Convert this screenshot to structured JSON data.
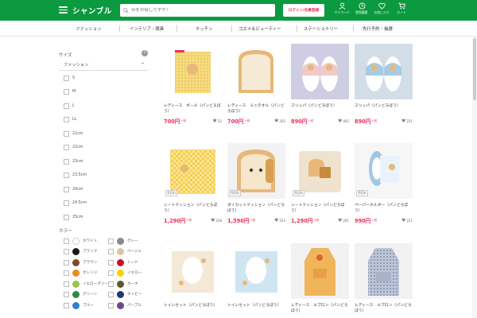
{
  "header": {
    "logo": "シャンブル",
    "search_placeholder": "何をお探しですか？",
    "login_label": "ログイン/会員登録",
    "icons": [
      {
        "name": "mypage-icon",
        "label": "マイページ"
      },
      {
        "name": "history-icon",
        "label": "閲覧履歴"
      },
      {
        "name": "favorite-icon",
        "label": "お気に入り"
      },
      {
        "name": "cart-icon",
        "label": "カート"
      }
    ]
  },
  "categories": [
    "ファッション",
    "インテリア・寝具",
    "キッチン",
    "コスメ＆ビューティー",
    "ステーショナリー",
    "先行予約・抽選"
  ],
  "sidebar": {
    "size_heading": "サイズ",
    "fashion_label": "ファッション",
    "sizes": [
      "S",
      "M",
      "L",
      "LL",
      "21cm",
      "22cm",
      "23cm",
      "23.5cm",
      "24cm",
      "24.5cm",
      "25cm"
    ],
    "color_heading": "カラー",
    "colors": [
      {
        "name": "ホワイト",
        "hex": "#ffffff"
      },
      {
        "name": "グレー",
        "hex": "#8a8a8a"
      },
      {
        "name": "ブラック",
        "hex": "#1a1a1a"
      },
      {
        "name": "ベージュ",
        "hex": "#d8c6a4"
      },
      {
        "name": "ブラウン",
        "hex": "#7a4b27"
      },
      {
        "name": "レッド",
        "hex": "#c8102e"
      },
      {
        "name": "オレンジ",
        "hex": "#f08a24"
      },
      {
        "name": "イエロー",
        "hex": "#f5d400"
      },
      {
        "name": "イエローグリーン",
        "hex": "#9bc34a"
      },
      {
        "name": "カーキ",
        "hex": "#5c5a2e"
      },
      {
        "name": "グリーン",
        "hex": "#2f8a3e"
      },
      {
        "name": "ネイビー",
        "hex": "#1f3a6b"
      },
      {
        "name": "ブルー",
        "hex": "#2f7fd1"
      },
      {
        "name": "パープル",
        "hex": "#6a4a8f"
      }
    ]
  },
  "products": [
    {
      "title": "レディース　ボール（パンどろぼう）",
      "price": "700円",
      "tax": "+税",
      "likes": "22",
      "badge": "",
      "type": "towel"
    },
    {
      "title": "レディース　ミニタオル（パンどろぼう）",
      "price": "700円",
      "tax": "+税",
      "likes": "202",
      "badge": "",
      "type": "bread"
    },
    {
      "title": "スリッパ（パンどろぼう）",
      "price": "890円",
      "tax": "+税",
      "likes": "492",
      "badge": "",
      "type": "slipper"
    },
    {
      "title": "スリッパ（パンどろぼう）",
      "price": "890円",
      "tax": "+税",
      "likes": "231",
      "badge": "",
      "type": "slipper2"
    },
    {
      "title": "シートクッション（パンどろぼう）",
      "price": "1,290円",
      "tax": "+税",
      "likes": "228",
      "badge": "売切れ",
      "type": "check"
    },
    {
      "title": "ダイカットクッション（パンどろぼう）",
      "price": "1,590円",
      "tax": "+税",
      "likes": "224",
      "badge": "売切れ",
      "type": "diecut"
    },
    {
      "title": "シートクッション（パンどろぼう）",
      "price": "1,290円",
      "tax": "+税",
      "likes": "261",
      "badge": "売切れ",
      "type": "square"
    },
    {
      "title": "ペーパーホルダー（パンどろぼう）",
      "price": "990円",
      "tax": "+税",
      "likes": "221",
      "badge": "売切れ",
      "type": "holder"
    },
    {
      "title": "トイレセット（パンどろぼう）",
      "price": "",
      "tax": "",
      "likes": "",
      "badge": "",
      "type": "toilet1"
    },
    {
      "title": "トイレセット（パンどろぼう）",
      "price": "",
      "tax": "",
      "likes": "",
      "badge": "",
      "type": "toilet2"
    },
    {
      "title": "レディース　エプロン（パンどろぼう）",
      "price": "",
      "tax": "",
      "likes": "",
      "badge": "",
      "type": "apron1"
    },
    {
      "title": "レディース　エプロン（パンどろぼう）",
      "price": "",
      "tax": "",
      "likes": "",
      "badge": "",
      "type": "apron2"
    }
  ]
}
